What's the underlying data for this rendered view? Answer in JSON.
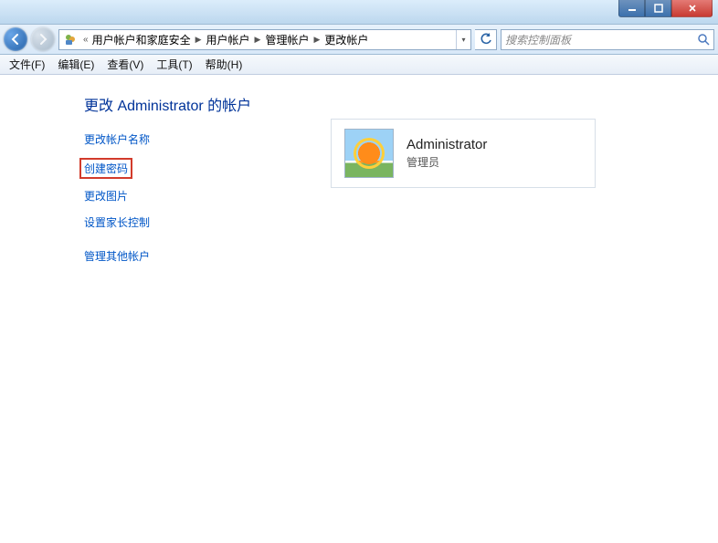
{
  "window": {
    "min_tip": "Minimize",
    "max_tip": "Maximize",
    "close_tip": "Close"
  },
  "breadcrumb": {
    "prefix": "«",
    "items": [
      "用户帐户和家庭安全",
      "用户帐户",
      "管理帐户",
      "更改帐户"
    ]
  },
  "search": {
    "placeholder": "搜索控制面板"
  },
  "menu": {
    "file": "文件(F)",
    "edit": "编辑(E)",
    "view": "查看(V)",
    "tools": "工具(T)",
    "help": "帮助(H)"
  },
  "page": {
    "heading": "更改 Administrator 的帐户",
    "tasks": {
      "rename": "更改帐户名称",
      "password": "创建密码",
      "picture": "更改图片",
      "parental": "设置家长控制",
      "other": "管理其他帐户"
    }
  },
  "user": {
    "name": "Administrator",
    "type": "管理员"
  }
}
